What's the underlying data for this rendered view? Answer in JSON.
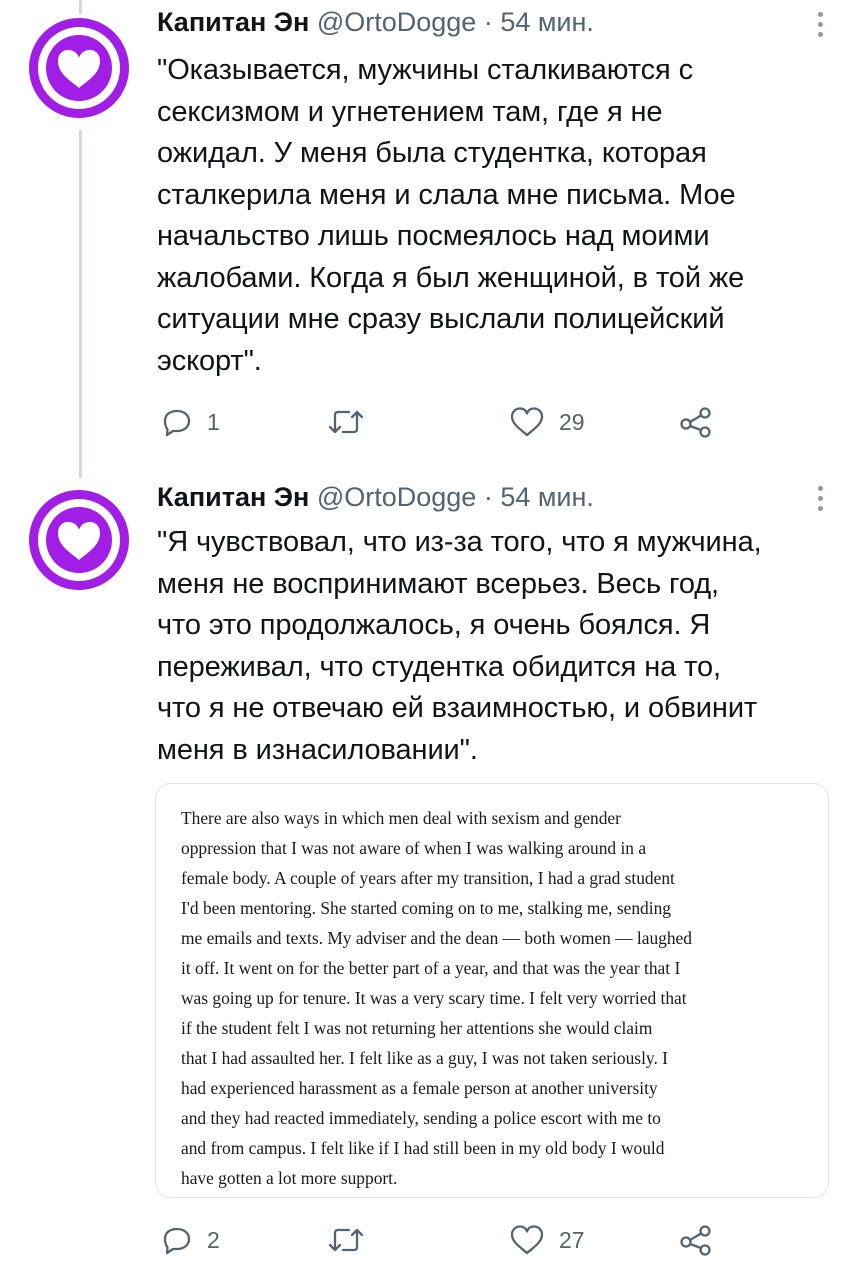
{
  "tweets": [
    {
      "author": "Капитан Эн",
      "handle": "@OrtoDogge",
      "dot": "·",
      "time": "54 мин.",
      "text": "\"Оказывается, мужчины сталкиваются с\nсексизмом и угнетением там, где я не\nожидал. У меня была студентка, которая\nсталкерила меня и слала мне письма. Мое\nначальство лишь посмеялось над моими\nжалобами. Когда я был женщиной, в той же\nситуации мне сразу выслали полицейский\nэскорт\".",
      "reply_count": "1",
      "retweet_count": "",
      "like_count": "29"
    },
    {
      "author": "Капитан Эн",
      "handle": "@OrtoDogge",
      "dot": "·",
      "time": "54 мин.",
      "text": "\"Я чувствовал, что из-за того, что я мужчина,\nменя не воспринимают всерьез. Весь год,\nчто это продолжалось, я очень боялся. Я\nпереживал, что студентка обидится на то,\nчто я не отвечаю ей взаимностью, и обвинит\nменя в изнасиловании\".",
      "quote_text": "There are also ways in which men deal with sexism and gender\noppression that I was not aware of when I was walking around in a\nfemale body. A couple of years after my transition, I had a grad student\nI'd been mentoring. She started coming on to me, stalking me, sending\nme emails and texts. My adviser and the dean — both women — laughed\nit off. It went on for the better part of a year, and that was the year that I\nwas going up for tenure. It was a very scary time. I felt very worried that\nif the student felt I was not returning her attentions she would claim\nthat I had assaulted her. I felt like as a guy, I was not taken seriously. I\nhad experienced harassment as a female person at another university\nand they had reacted immediately, sending a police escort with me to\nand from campus. I felt like if I had still been in my old body I would\nhave gotten a lot more support.",
      "reply_count": "2",
      "retweet_count": "",
      "like_count": "27"
    }
  ],
  "colors": {
    "avatar_purple": "#a11ee6",
    "muted": "#536471",
    "text": "#0f1419",
    "thread_line": "#cfd9de"
  },
  "icons": [
    "heart-logo-icon",
    "more-options-icon",
    "reply-icon",
    "retweet-icon",
    "like-icon",
    "share-icon"
  ]
}
